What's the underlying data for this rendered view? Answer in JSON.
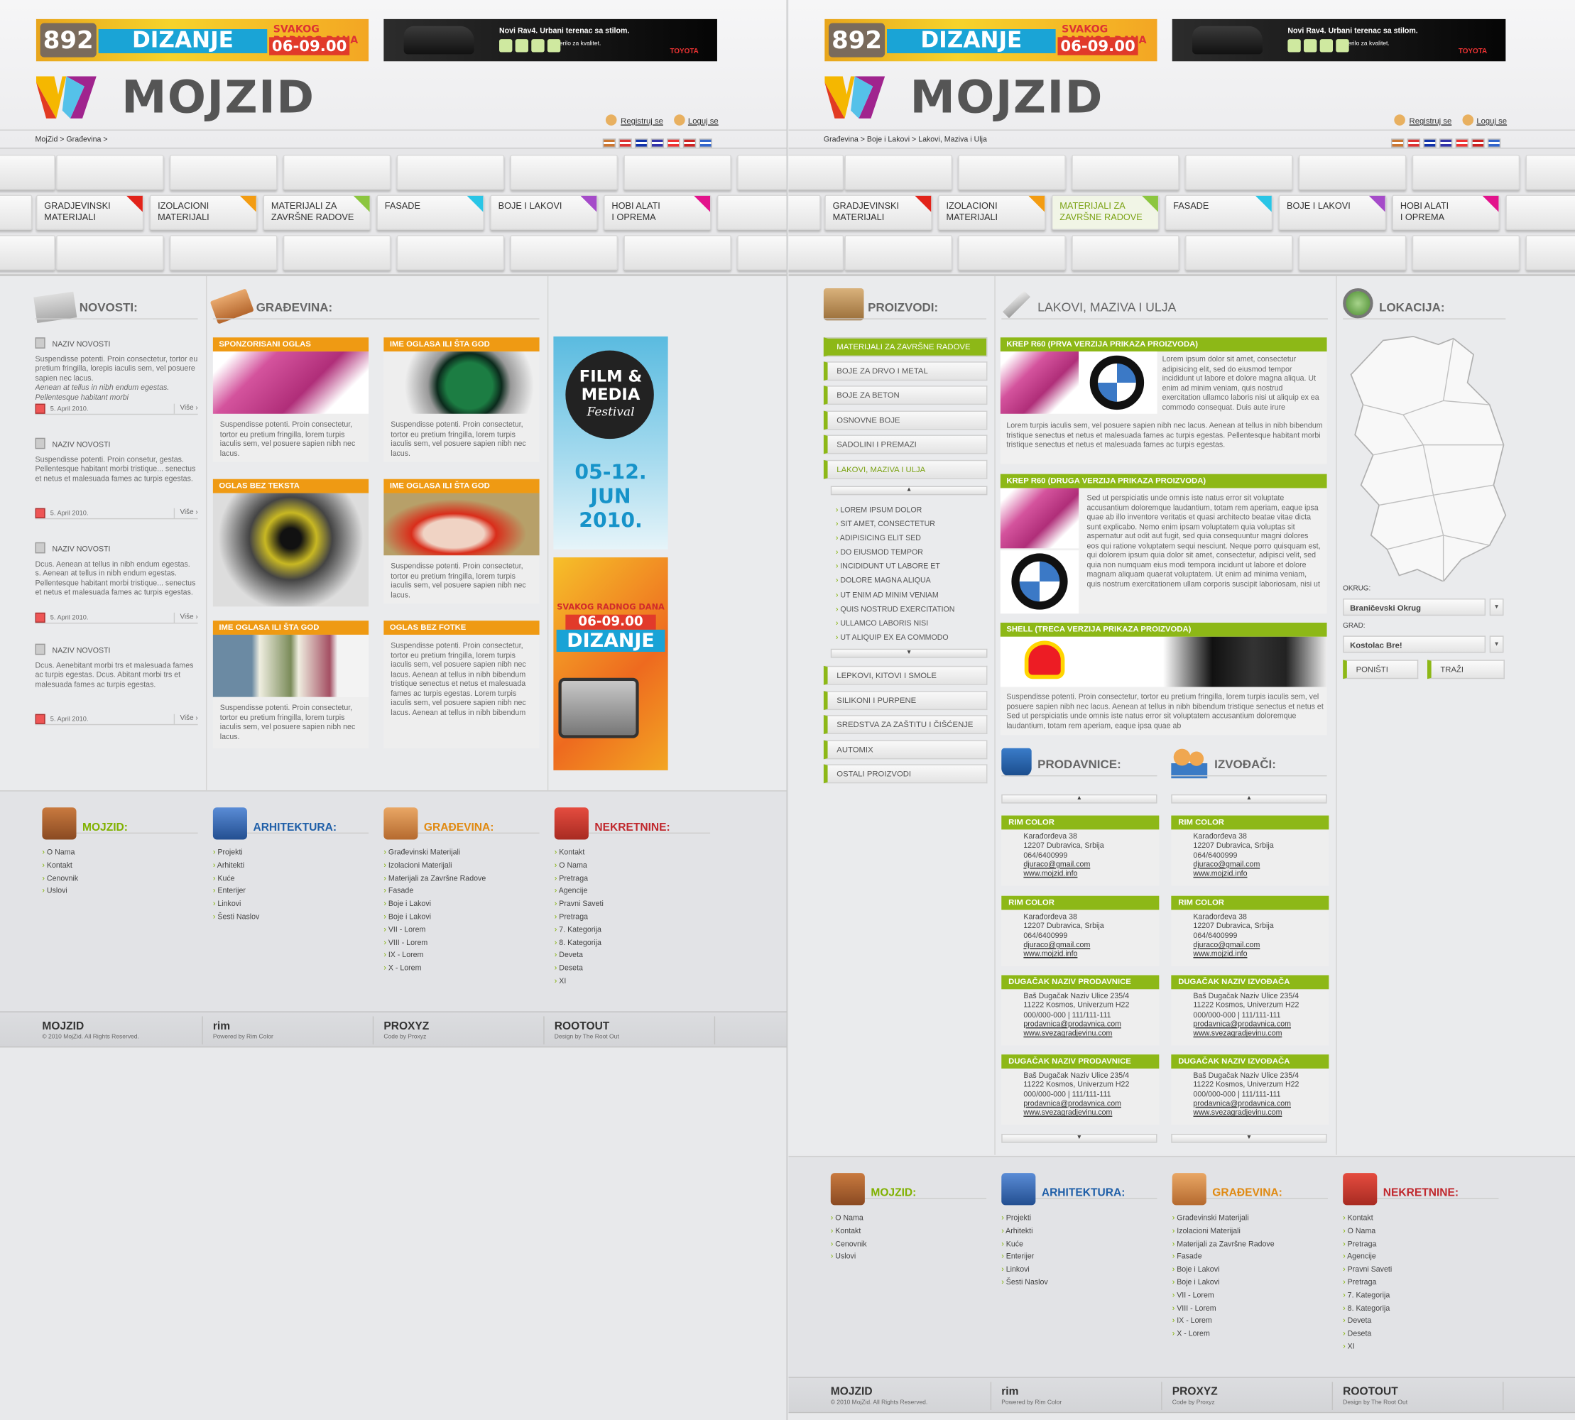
{
  "banner": {
    "b892": "892",
    "dizanje": "DIZANJE",
    "svakog": "SVAKOG RADNOG DANA",
    "time": "06-09.00",
    "toyota_title": "Novi Rav4. Urbani terenac sa stilom.",
    "toyota_sub": "Merilo za kvalitet.",
    "toyota_brand": "TOYOTA"
  },
  "logo": "MOJZID",
  "auth": {
    "register": "Registruj se",
    "login": "Loguj se"
  },
  "left": {
    "breadcrumb": "MojZid > Građevina >"
  },
  "right": {
    "breadcrumb": "Građevina > Boje i Lakovi > Lakovi, Maziva i Ulja"
  },
  "nav": [
    {
      "line1": "Gradjevinski",
      "line2": "materijali",
      "color": "#e2231a"
    },
    {
      "line1": "Izolacioni",
      "line2": "materijali",
      "color": "#f39c12"
    },
    {
      "line1": "Materijali za",
      "line2": "završne radove",
      "color": "#8cc63f"
    },
    {
      "line1": "Fasade",
      "line2": "",
      "color": "#29c5e6"
    },
    {
      "line1": "Boje i lakovi",
      "line2": "",
      "color": "#a54bc9"
    },
    {
      "line1": "Hobi alati",
      "line2": "i oprema",
      "color": "#e3138c"
    }
  ],
  "novosti": {
    "title": "NOVOSTI:",
    "items": [
      {
        "title": "NAZIV NOVOSTI",
        "text": "Suspendisse potenti. Proin consectetur, tortor eu pretium fringilla, lorepis iaculis sem, vel posuere sapien nec lacus.",
        "italic": "Aenean at tellus in nibh endum egestas. Pellentesque habitant morbi",
        "date": "5. April 2010.",
        "more": "Više ›"
      },
      {
        "title": "NAZIV NOVOSTI",
        "text": "Suspendisse potenti. Proin consetur, gestas. Pellentesque habitant morbi tristique... senectus et netus et malesuada fames ac turpis egestas.",
        "italic": "",
        "date": "5. April 2010.",
        "more": "Više ›"
      },
      {
        "title": "NAZIV NOVOSTI",
        "text": "Dcus. Aenean at tellus in nibh endum egestas. s. Aenean at tellus in nibh endum egestas. Pellentesque habitant morbi tristique... senectus et netus et malesuada fames ac turpis egestas.",
        "italic": "",
        "date": "5. April 2010.",
        "more": "Više ›"
      },
      {
        "title": "NAZIV NOVOSTI",
        "text": "Dcus. Aenebitant morbi trs et malesuada fames ac turpis egestas. Dcus. Abitant morbi trs et malesuada fames ac turpis egestas.",
        "italic": "",
        "date": "5. April 2010.",
        "more": "Više ›"
      }
    ]
  },
  "gradjevina": {
    "title": "GRAĐEVINA:",
    "ads": [
      {
        "title": "SPONZORISANI OGLAS",
        "text": "Suspendisse potenti. Proin consectetur, tortor eu pretium fringilla, lorem turpis iaculis sem, vel posuere sapien nibh nec lacus."
      },
      {
        "title": "IME OGLASA ILI ŠTA GOD",
        "text": "Suspendisse potenti. Proin consectetur, tortor eu pretium fringilla, lorem turpis iaculis sem, vel posuere sapien nibh nec lacus."
      },
      {
        "title": "OGLAS BEZ TEKSTA",
        "text": ""
      },
      {
        "title": "IME OGLASA ILI ŠTA GOD",
        "text": "Suspendisse potenti. Proin consectetur, tortor eu pretium fringilla, lorem turpis iaculis sem, vel posuere sapien nibh nec lacus."
      },
      {
        "title": "IME OGLASA ILI ŠTA GOD",
        "text": "Suspendisse potenti. Proin consectetur, tortor eu pretium fringilla, lorem turpis iaculis sem, vel posuere sapien nibh nec lacus."
      },
      {
        "title": "OGLAS BEZ FOTKE",
        "text": "Suspendisse potenti. Proin consectetur, tortor eu pretium fringilla, lorem turpis iaculis sem, vel posuere sapien nibh nec lacus. Aenean at tellus in nibh bibendum tristique senectus et netus et malesuada fames ac turpis egestas. Lorem turpis iaculis sem, vel posuere sapien nibh nec lacus. Aenean at tellus in nibh bibendum"
      }
    ]
  },
  "side_ads": {
    "film1": "FILM &",
    "film2": "MEDIA",
    "film3": "Festival",
    "dates1": "05-12.",
    "dates2": "JUN",
    "dates3": "2010.",
    "svakog": "SVAKOG RADNOG DANA",
    "time": "06-09.00",
    "dizanje": "DIZANJE",
    "b892": "892"
  },
  "footer": {
    "mojzid": {
      "title": "MOJZID:",
      "color": "#80b100",
      "items": [
        "O Nama",
        "Kontakt",
        "Cenovnik",
        "Uslovi"
      ]
    },
    "arhitektura": {
      "title": "ARHITEKTURA:",
      "color": "#1f5fa8",
      "items": [
        "Projekti",
        "Arhitekti",
        "Kuće",
        "Enterijer",
        "Linkovi",
        "Šesti Naslov"
      ]
    },
    "gradjevina": {
      "title": "GRAĐEVINA:",
      "color": "#e08a12",
      "items": [
        "Građevinski Materijali",
        "Izolacioni Materijali",
        "Materijali za Završne Radove",
        "Fasade",
        "Boje i Lakovi",
        "Boje i Lakovi",
        "VII - Lorem",
        "VIII - Lorem",
        "IX - Lorem",
        "X - Lorem"
      ]
    },
    "nekretnine": {
      "title": "NEKRETNINE:",
      "color": "#c0282d",
      "items": [
        "Kontakt",
        "O Nama",
        "Pretraga",
        "Agencije",
        "Pravni Saveti",
        "Pretraga",
        "7. Kategorija",
        "8. Kategorija",
        "Deveta",
        "Deseta",
        "XI"
      ]
    }
  },
  "footbar": {
    "copy": "© 2010 MojZid. All Rights Reserved.",
    "rim": "rim",
    "rimsub": "COLOR",
    "rimpow": "Powered by Rim Color",
    "proxyz": "PROXYZ",
    "proxyzsub": "Code by Proxyz",
    "root": "ROOTOUT",
    "rootthe": "THE",
    "rootsub": "Design by The Root Out"
  },
  "proizvodi": {
    "title": "PROIZVODI:",
    "cats": [
      "Materijali za završne radove",
      "Boje za drvo i metal",
      "Boje za beton",
      "Osnovne boje",
      "Sadolini i premazi",
      "Lakovi, maziva i ulja"
    ],
    "sub": [
      "Lorem ipsum dolor",
      "Sit amet, consectetur",
      "Adipisicing elit sed",
      "Do eiusmod tempor",
      "Incididunt ut labore et",
      "Dolore magna aliqua",
      "Ut enim ad minim veniam",
      "Quis nostrud exercitation",
      "Ullamco laboris nisi",
      "Ut aliquip ex ea commodo"
    ],
    "cats2": [
      "Lepkovi, kitovi i smole",
      "Silikoni i purpene",
      "Sredstva za zaštitu i čišćenje",
      "Automix",
      "Ostali proizvodi"
    ]
  },
  "lakovi": {
    "title": "LAKOVI, MAZIVA I ULJA",
    "products": [
      {
        "title": "KREP R60 (PRVA VERZIJA PRIKAZA PROIZVODA)",
        "text": "Lorem ipsum dolor sit amet, consectetur adipisicing elit, sed do eiusmod tempor incididunt ut labore et dolore magna aliqua. Ut enim ad minim veniam, quis nostrud exercitation ullamco laboris nisi ut aliquip ex ea commodo consequat. Duis aute irure",
        "text2": "Lorem turpis iaculis sem, vel posuere sapien nibh nec lacus. Aenean at tellus in nibh bibendum tristique senectus et netus et malesuada fames ac turpis egestas. Pellentesque habitant morbi tristique senectus et netus et malesuada fames ac turpis egestas."
      },
      {
        "title": "KREP R60 (DRUGA VERZIJA PRIKAZA PROIZVODA)",
        "text": "Sed ut perspiciatis unde omnis iste natus error sit voluptate accusantium doloremque laudantium, totam rem aperiam, eaque ipsa quae ab illo inventore veritatis et quasi architecto beatae vitae dicta sunt explicabo. Nemo enim ipsam voluptatem quia voluptas sit aspernatur aut odit aut fugit, sed quia consequuntur magni dolores eos qui ratione voluptatem sequi nesciunt. Neque porro quisquam est, qui dolorem ipsum quia dolor sit amet, consectetur, adipisci velit, sed quia non numquam eius modi tempora incidunt ut labore et dolore magnam aliquam quaerat voluptatem. Ut enim ad minima veniam, quis nostrum exercitationem ullam corporis suscipit laboriosam, nisi ut"
      },
      {
        "title": "SHELL (TRECA VERZIJA PRIKAZA PROIZVODA)",
        "text": "Suspendisse potenti. Proin consectetur, tortor eu pretium fringilla, lorem turpis iaculis sem, vel posuere sapien nibh nec lacus. Aenean at tellus in nibh bibendum tristique senectus et netus et Sed ut perspiciatis unde omnis iste natus error sit voluptatem accusantium doloremque laudantium, totam rem aperiam, eaque ipsa quae ab"
      }
    ]
  },
  "prodavnice": {
    "title": "PRODAVNICE:",
    "shops": [
      {
        "name": "RIM COLOR",
        "l1": "Karađorđeva 38",
        "l2": "12207 Dubravica, Srbija",
        "l3": "064/6400999",
        "l4": "djuraco@gmail.com",
        "l5": "www.mojzid.info"
      },
      {
        "name": "RIM COLOR",
        "l1": "Karađorđeva 38",
        "l2": "12207 Dubravica, Srbija",
        "l3": "064/6400999",
        "l4": "djuraco@gmail.com",
        "l5": "www.mojzid.info"
      },
      {
        "name": "DUGAČAK NAZIV PRODAVNICE",
        "l1": "Baš Dugačak Naziv Ulice 235/4",
        "l2": "11222 Kosmos, Univerzum H22",
        "l3": "000/000-000 | 111/111-111",
        "l4": "prodavnica@prodavnica.com",
        "l5": "www.svezagradjevinu.com"
      },
      {
        "name": "DUGAČAK NAZIV PRODAVNICE",
        "l1": "Baš Dugačak Naziv Ulice 235/4",
        "l2": "11222 Kosmos, Univerzum H22",
        "l3": "000/000-000 | 111/111-111",
        "l4": "prodavnica@prodavnica.com",
        "l5": "www.svezagradjevinu.com"
      }
    ]
  },
  "izvodjaci": {
    "title": "IZVOĐAČI:",
    "shops": [
      {
        "name": "RIM COLOR",
        "l1": "Karađorđeva 38",
        "l2": "12207 Dubravica, Srbija",
        "l3": "064/6400999",
        "l4": "djuraco@gmail.com",
        "l5": "www.mojzid.info"
      },
      {
        "name": "RIM COLOR",
        "l1": "Karađorđeva 38",
        "l2": "12207 Dubravica, Srbija",
        "l3": "064/6400999",
        "l4": "djuraco@gmail.com",
        "l5": "www.mojzid.info"
      },
      {
        "name": "DUGAČAK NAZIV IZVOĐAČA",
        "l1": "Baš Dugačak Naziv Ulice 235/4",
        "l2": "11222 Kosmos, Univerzum H22",
        "l3": "000/000-000 | 111/111-111",
        "l4": "prodavnica@prodavnica.com",
        "l5": "www.svezagradjevinu.com"
      },
      {
        "name": "DUGAČAK NAZIV IZVOĐAČA",
        "l1": "Baš Dugačak Naziv Ulice 235/4",
        "l2": "11222 Kosmos, Univerzum H22",
        "l3": "000/000-000 | 111/111-111",
        "l4": "prodavnica@prodavnica.com",
        "l5": "www.svezagradjevinu.com"
      }
    ]
  },
  "lokacija": {
    "title": "LOKACIJA:",
    "okrug_label": "OKRUG:",
    "okrug_value": "Braničevski Okrug",
    "grad_label": "GRAD:",
    "grad_value": "Kostolac Bre!",
    "reset": "PONIŠTI",
    "search": "TRAŽI"
  },
  "arrows": {
    "up": "▲",
    "down": "▼"
  }
}
